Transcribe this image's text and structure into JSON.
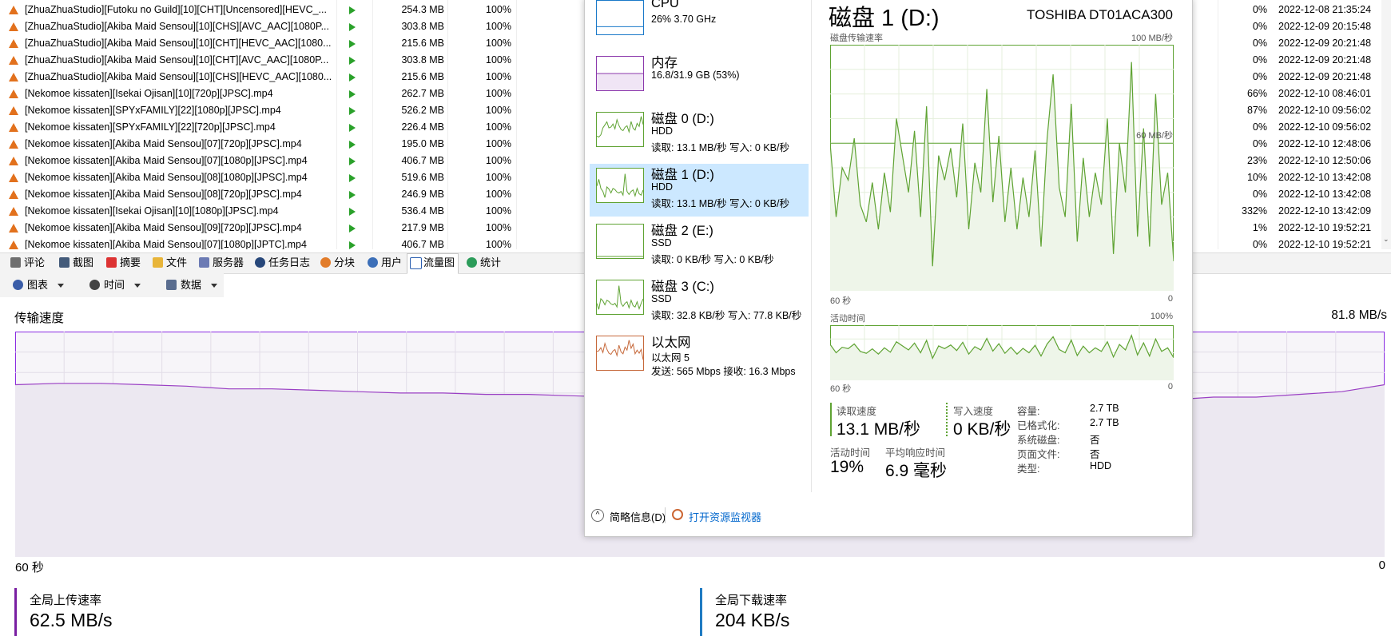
{
  "torrents": [
    {
      "name": "[ZhuaZhuaStudio][Futoku no Guild][10][CHT][Uncensored][HEVC_...",
      "size": "254.3 MB",
      "progress": "100%",
      "ratio": "0%",
      "completed": "2022-12-08 21:35:24"
    },
    {
      "name": "[ZhuaZhuaStudio][Akiba Maid Sensou][10][CHS][AVC_AAC][1080P...",
      "size": "303.8 MB",
      "progress": "100%",
      "ratio": "0%",
      "completed": "2022-12-09 20:15:48"
    },
    {
      "name": "[ZhuaZhuaStudio][Akiba Maid Sensou][10][CHT][HEVC_AAC][1080...",
      "size": "215.6 MB",
      "progress": "100%",
      "ratio": "0%",
      "completed": "2022-12-09 20:21:48"
    },
    {
      "name": "[ZhuaZhuaStudio][Akiba Maid Sensou][10][CHT][AVC_AAC][1080P...",
      "size": "303.8 MB",
      "progress": "100%",
      "ratio": "0%",
      "completed": "2022-12-09 20:21:48"
    },
    {
      "name": "[ZhuaZhuaStudio][Akiba Maid Sensou][10][CHS][HEVC_AAC][1080...",
      "size": "215.6 MB",
      "progress": "100%",
      "ratio": "0%",
      "completed": "2022-12-09 20:21:48"
    },
    {
      "name": "[Nekomoe kissaten][Isekai Ojisan][10][720p][JPSC].mp4",
      "size": "262.7 MB",
      "progress": "100%",
      "ratio": "66%",
      "completed": "2022-12-10 08:46:01"
    },
    {
      "name": "[Nekomoe kissaten][SPYxFAMILY][22][1080p][JPSC].mp4",
      "size": "526.2 MB",
      "progress": "100%",
      "ratio": "87%",
      "completed": "2022-12-10 09:56:02"
    },
    {
      "name": "[Nekomoe kissaten][SPYxFAMILY][22][720p][JPSC].mp4",
      "size": "226.4 MB",
      "progress": "100%",
      "ratio": "0%",
      "completed": "2022-12-10 09:56:02"
    },
    {
      "name": "[Nekomoe kissaten][Akiba Maid Sensou][07][720p][JPSC].mp4",
      "size": "195.0 MB",
      "progress": "100%",
      "ratio": "0%",
      "completed": "2022-12-10 12:48:06"
    },
    {
      "name": "[Nekomoe kissaten][Akiba Maid Sensou][07][1080p][JPSC].mp4",
      "size": "406.7 MB",
      "progress": "100%",
      "ratio": "23%",
      "completed": "2022-12-10 12:50:06"
    },
    {
      "name": "[Nekomoe kissaten][Akiba Maid Sensou][08][1080p][JPSC].mp4",
      "size": "519.6 MB",
      "progress": "100%",
      "ratio": "10%",
      "completed": "2022-12-10 13:42:08"
    },
    {
      "name": "[Nekomoe kissaten][Akiba Maid Sensou][08][720p][JPSC].mp4",
      "size": "246.9 MB",
      "progress": "100%",
      "ratio": "0%",
      "completed": "2022-12-10 13:42:08"
    },
    {
      "name": "[Nekomoe kissaten][Isekai Ojisan][10][1080p][JPSC].mp4",
      "size": "536.4 MB",
      "progress": "100%",
      "ratio": "332%",
      "completed": "2022-12-10 13:42:09"
    },
    {
      "name": "[Nekomoe kissaten][Akiba Maid Sensou][09][720p][JPSC].mp4",
      "size": "217.9 MB",
      "progress": "100%",
      "ratio": "1%",
      "completed": "2022-12-10 19:52:21"
    },
    {
      "name": "[Nekomoe kissaten][Akiba Maid Sensou][07][1080p][JPTC].mp4",
      "size": "406.7 MB",
      "progress": "100%",
      "ratio": "0%",
      "completed": "2022-12-10 19:52:21"
    }
  ],
  "tabs": [
    "评论",
    "截图",
    "摘要",
    "文件",
    "服务器",
    "任务日志",
    "分块",
    "用户",
    "流量图",
    "统计"
  ],
  "active_tab": "流量图",
  "graph_toolbar": [
    "图表",
    "时间",
    "数据"
  ],
  "transfer": {
    "title": "传输速度",
    "max_label": "81.8 MB/s",
    "x_left": "60 秒",
    "x_right": "0",
    "upload_label": "全局上传速率",
    "upload_value": "62.5 MB/s",
    "download_label": "全局下载速率",
    "download_value": "204 KB/s"
  },
  "taskmgr": {
    "tiles": [
      {
        "name": "CPU",
        "line2": "26% 3.70 GHz",
        "line3": ""
      },
      {
        "name": "内存",
        "line2": "16.8/31.9 GB (53%)",
        "line3": ""
      },
      {
        "name": "磁盘 0 (D:)",
        "line2": "HDD",
        "line3": "读取: 13.1 MB/秒 写入: 0 KB/秒"
      },
      {
        "name": "磁盘 1 (D:)",
        "line2": "HDD",
        "line3": "读取: 13.1 MB/秒 写入: 0 KB/秒"
      },
      {
        "name": "磁盘 2 (E:)",
        "line2": "SSD",
        "line3": "读取: 0 KB/秒 写入: 0 KB/秒"
      },
      {
        "name": "磁盘 3 (C:)",
        "line2": "SSD",
        "line3": "读取: 32.8 KB/秒 写入: 77.8 KB/秒"
      },
      {
        "name": "以太网",
        "line2": "以太网 5",
        "line3": "发送: 565 Mbps 接收: 16.3 Mbps"
      }
    ],
    "selected_tile": "磁盘 1 (D:)",
    "title": "磁盘 1 (D:)",
    "model": "TOSHIBA DT01ACA300",
    "chart1_label": "磁盘传输速率",
    "chart1_max": "100 MB/秒",
    "chart1_mid": "60 MB/秒",
    "chart1_x_left": "60 秒",
    "chart1_x_right": "0",
    "chart2_label": "活动时间",
    "chart2_max": "100%",
    "chart2_x_left": "60 秒",
    "chart2_x_right": "0",
    "read_label": "读取速度",
    "read_value": "13.1 MB/秒",
    "write_label": "写入速度",
    "write_value": "0 KB/秒",
    "active_label": "活动时间",
    "active_value": "19%",
    "resp_label": "平均响应时间",
    "resp_value": "6.9 毫秒",
    "info": [
      {
        "k": "容量:",
        "v": "2.7 TB"
      },
      {
        "k": "已格式化:",
        "v": "2.7 TB"
      },
      {
        "k": "系统磁盘:",
        "v": "否"
      },
      {
        "k": "页面文件:",
        "v": "否"
      },
      {
        "k": "类型:",
        "v": "HDD"
      }
    ],
    "footer_fewer": "简略信息(D)",
    "footer_monitor": "打开资源监视器"
  },
  "chart_data": [
    {
      "type": "area",
      "title": "磁盘传输速率",
      "ylim": [
        0,
        100
      ],
      "y_unit": "MB/秒",
      "x": "60 秒 → 0",
      "values": [
        60,
        30,
        50,
        45,
        62,
        35,
        28,
        44,
        25,
        48,
        32,
        70,
        55,
        40,
        65,
        30,
        75,
        10,
        55,
        45,
        58,
        38,
        68,
        25,
        52,
        40,
        82,
        36,
        63,
        28,
        50,
        25,
        46,
        30,
        57,
        18,
        62,
        88,
        42,
        30,
        76,
        20,
        54,
        30,
        48,
        35,
        70,
        15,
        60,
        40,
        93,
        22,
        66,
        18,
        80,
        35,
        48,
        12
      ]
    },
    {
      "type": "area",
      "title": "活动时间",
      "ylim": [
        0,
        100
      ],
      "y_unit": "%",
      "values": [
        60,
        30,
        50,
        45,
        62,
        35,
        28,
        44,
        25,
        48,
        32,
        70,
        55,
        40,
        65,
        30,
        75,
        10,
        55,
        45,
        58,
        38,
        68,
        25,
        52,
        40,
        82,
        36,
        63,
        28,
        50,
        25,
        46,
        30,
        57,
        18,
        62,
        88,
        42,
        30,
        76,
        20,
        54,
        30,
        48,
        35,
        70,
        15,
        60,
        40,
        93,
        22,
        66,
        18,
        80,
        35,
        48,
        12
      ]
    },
    {
      "type": "line",
      "title": "传输速度",
      "ylim": [
        0,
        81.8
      ],
      "y_unit": "MB/s",
      "values": [
        62.5,
        63,
        63,
        62.5,
        62,
        61,
        61,
        60.5,
        60,
        59.5,
        59.5,
        59,
        59,
        58.5,
        58,
        58,
        57.5,
        57.5,
        57,
        57,
        56.5,
        56,
        56,
        55.5,
        55.5,
        55.5,
        56,
        57,
        58,
        58,
        59,
        60,
        62.5
      ]
    }
  ]
}
